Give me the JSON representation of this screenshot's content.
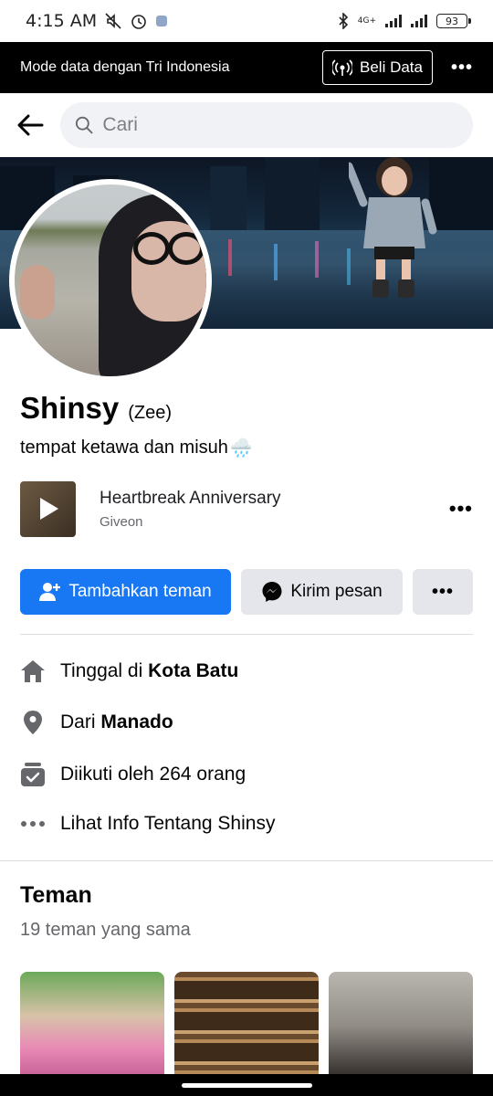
{
  "status_bar": {
    "time": "4:15 AM",
    "network": "4G+",
    "battery": "93"
  },
  "data_banner": {
    "message": "Mode data dengan Tri Indonesia",
    "buy_label": "Beli Data"
  },
  "search": {
    "placeholder": "Cari"
  },
  "profile": {
    "name": "Shinsy",
    "alternate_name": "(Zee)",
    "bio": "tempat ketawa dan misuh",
    "bio_emoji": "🌧️"
  },
  "music": {
    "title": "Heartbreak Anniversary",
    "artist": "Giveon"
  },
  "actions": {
    "add_friend": "Tambahkan teman",
    "message": "Kirim pesan"
  },
  "details": {
    "lives_prefix": "Tinggal di ",
    "lives_place": "Kota Batu",
    "from_prefix": "Dari ",
    "from_place": "Manado",
    "followed": "Diikuti oleh 264 orang",
    "see_info": "Lihat Info Tentang Shinsy"
  },
  "friends": {
    "title": "Teman",
    "mutual": "19 teman yang sama"
  },
  "colors": {
    "primary": "#1877f2",
    "secondary_button": "#e4e6eb",
    "search_bg": "#f0f2f5",
    "banner_bg": "#000000"
  }
}
